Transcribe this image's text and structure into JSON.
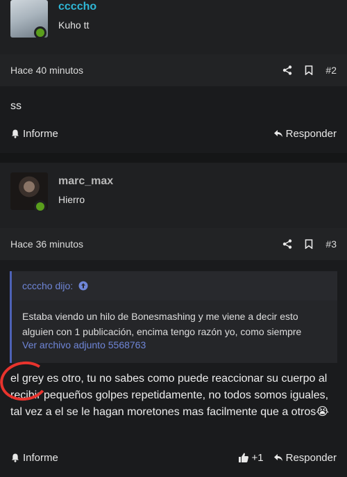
{
  "post1": {
    "username": "ccccho",
    "rank": "Kuho tt",
    "time": "Hace 40 minutos",
    "number": "#2",
    "body": "ss",
    "report_label": "Informe",
    "reply_label": "Responder"
  },
  "post2": {
    "username": "marc_max",
    "rank": "Hierro",
    "time": "Hace 36 minutos",
    "number": "#3",
    "quote": {
      "author": "ccccho dijo:",
      "text": "Estaba viendo un hilo de Bonesmashing y me viene a decir esto alguien con 1 publicación, encima tengo razón yo, como siempre",
      "attachment_link": "Ver archivo adjunto 5568763"
    },
    "body": "el grey es otro, tu no sabes como puede reaccionar su cuerpo al recibir pequeños golpes repetidamente, no todos somos iguales, tal vez a el se le hagan moretones mas facilmente que a otros😭",
    "report_label": "Informe",
    "like_count": "+1",
    "reply_label": "Responder"
  },
  "colors": {
    "background": "#1a1b1d",
    "username_cyan": "#2fb7d6",
    "quote_accent": "#6f86d8",
    "online": "#5a9e1c",
    "annotation": "#e8332d"
  }
}
